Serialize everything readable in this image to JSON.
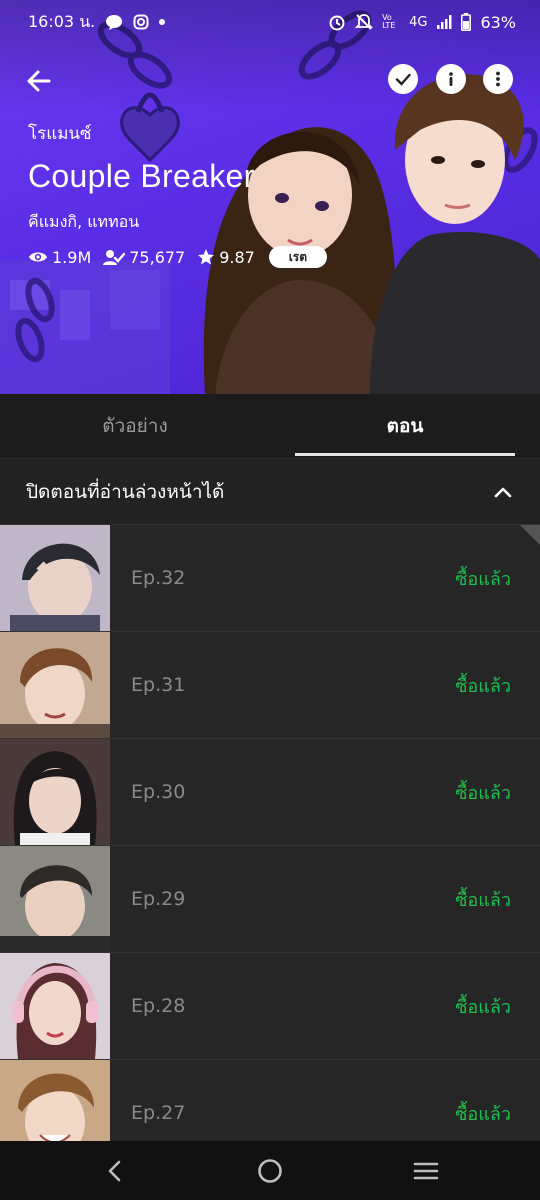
{
  "status_bar": {
    "time": "16:03 น.",
    "battery": "63%",
    "network": "4G",
    "volte": "Vo LTE"
  },
  "header": {
    "genre": "โรแมนซ์",
    "title": "Couple Breaker",
    "authors": "คีแมงกิ, แททอน",
    "views": "1.9M",
    "subscribers": "75,677",
    "rating": "9.87",
    "rate_button": "เรต"
  },
  "tabs": [
    {
      "label": "ตัวอย่าง",
      "active": false
    },
    {
      "label": "ตอน",
      "active": true
    }
  ],
  "collapse": {
    "label": "ปิดตอนที่อ่านล่วงหน้าได้"
  },
  "episodes": [
    {
      "label": "Ep.32",
      "status": "ซื้อแล้ว"
    },
    {
      "label": "Ep.31",
      "status": "ซื้อแล้ว"
    },
    {
      "label": "Ep.30",
      "status": "ซื้อแล้ว"
    },
    {
      "label": "Ep.29",
      "status": "ซื้อแล้ว"
    },
    {
      "label": "Ep.28",
      "status": "ซื้อแล้ว"
    },
    {
      "label": "Ep.27",
      "status": "ซื้อแล้ว"
    }
  ],
  "colors": {
    "accent_purple": "#5a2ee6",
    "purchased_green": "#1fbf4f",
    "background": "#1c1c1c"
  },
  "icons": {
    "back": "arrow-left-icon",
    "check": "check-icon",
    "info": "info-icon",
    "more": "more-vertical-icon",
    "views": "eye-icon",
    "subscribers": "user-check-icon",
    "rating": "star-icon",
    "collapse": "chevron-up-icon"
  }
}
